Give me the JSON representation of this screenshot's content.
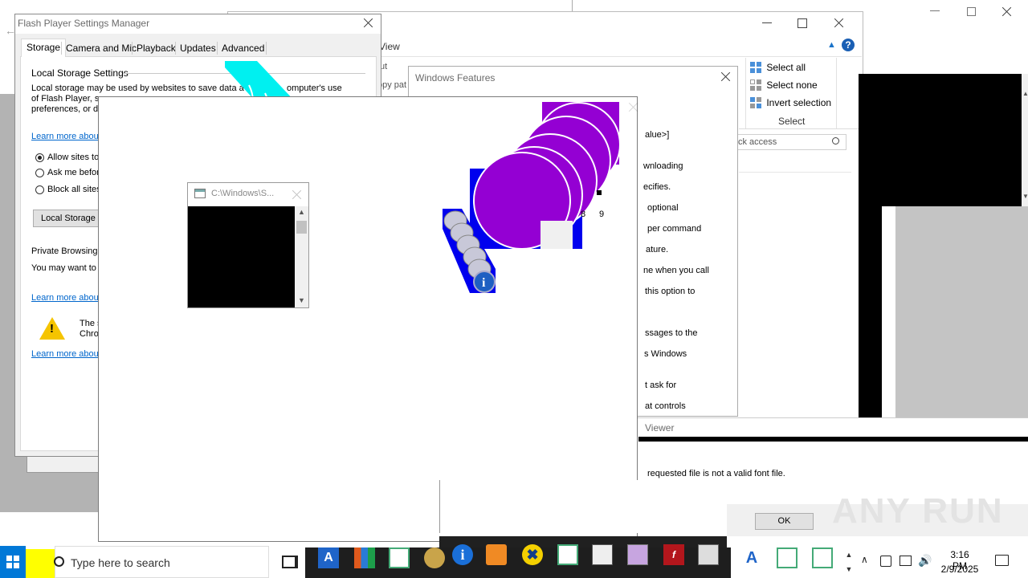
{
  "desktop": {
    "accent": "#0078d7",
    "desktop_color": "#ffffff"
  },
  "flash": {
    "title": "Flash Player Settings Manager",
    "tabs": [
      "Storage",
      "Camera and Mic",
      "Playback",
      "Updates",
      "Advanced"
    ],
    "section_title": "Local Storage Settings",
    "desc_line1": "Local storage may be used by websites to save data a",
    "desc_line1_end": "omputer's use",
    "desc_line2": "of Flash Player, s",
    "desc_line3": "preferences, or d",
    "learn_more": "Learn more about",
    "radio_allow": "Allow sites to",
    "radio_ask": "Ask me befor",
    "radio_block": "Block all sites",
    "local_storage_button": "Local Storage S",
    "private_title": "Private Browsing",
    "private_text": "You may want to",
    "warn_line1": "The s",
    "warn_line2": "Chro"
  },
  "explorer": {
    "view_label": "View",
    "frag_ut": "ut",
    "frag_path": "opy pat",
    "select_all": "Select all",
    "select_none": "Select none",
    "invert_selection": "Invert selection",
    "select_group": "Select",
    "search_placeholder": "ck access",
    "help_label": "?"
  },
  "features": {
    "title": "Windows Features",
    "lines": [
      "alue>]",
      "wnloading",
      "ecifies.",
      "optional",
      "per command",
      "ature.",
      "ne when you call",
      "this option to",
      "",
      "ssages to the",
      "s Windows",
      "",
      "t ask for",
      "at controls"
    ]
  },
  "cmd": {
    "title": "C:\\Windows\\S..."
  },
  "font_viewer": {
    "title": "Viewer",
    "message": "requested file  is not a valid font file.",
    "ok": "OK"
  },
  "cells": {
    "a": "8",
    "b": "9"
  },
  "watermark": "ANY RUN",
  "taskbar": {
    "search_placeholder": "Type here to search",
    "time": "3:16 PM",
    "date": "2/9/2025"
  }
}
